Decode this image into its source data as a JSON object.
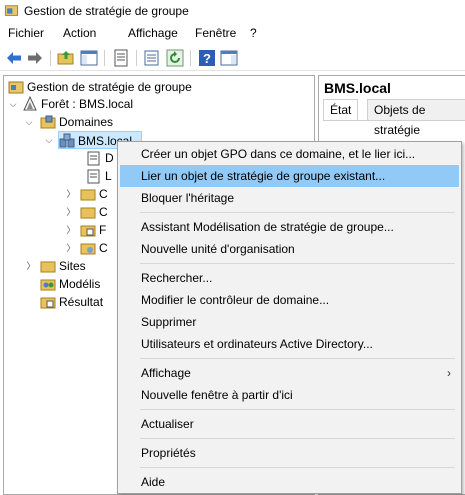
{
  "window": {
    "title": "Gestion de stratégie de groupe"
  },
  "menu": [
    "Fichier",
    "Action",
    "Affichage",
    "Fenêtre",
    "?"
  ],
  "toolbar": {
    "icons": [
      "back-arrow-icon",
      "forward-arrow-icon",
      "up-folder-icon",
      "show-hide-tree-icon",
      "properties-icon",
      "export-list-icon",
      "refresh-icon",
      "help-icon",
      "console-pane-icon"
    ]
  },
  "tree": {
    "root": "Gestion de stratégie de groupe",
    "forest": "Forêt : BMS.local",
    "domains": "Domaines",
    "domain": "BMS.local",
    "child1": "D",
    "child2": "L",
    "child3": "C",
    "child4": "C",
    "child5": "F",
    "child6": "C",
    "sites": "Sites",
    "modeling": "Modélis",
    "results": "Résultat"
  },
  "right_pane": {
    "title": "BMS.local",
    "tabs": [
      "État",
      "Objets de stratégie"
    ]
  },
  "context_menu": {
    "items": [
      "Créer un objet GPO dans ce domaine, et le lier ici...",
      "Lier un objet de stratégie de groupe existant...",
      "Bloquer l'héritage",
      "Assistant Modélisation de stratégie de groupe...",
      "Nouvelle unité d'organisation",
      "Rechercher...",
      "Modifier le contrôleur de domaine...",
      "Supprimer",
      "Utilisateurs et ordinateurs Active Directory...",
      "Affichage",
      "Nouvelle fenêtre à partir d'ici",
      "Actualiser",
      "Propriétés",
      "Aide"
    ],
    "highlighted": "Lier un objet de stratégie de groupe existant..."
  },
  "colors": {
    "highlight": "#91c9f7",
    "selection": "#cce8ff",
    "menu_bg": "#f2f2f2"
  }
}
